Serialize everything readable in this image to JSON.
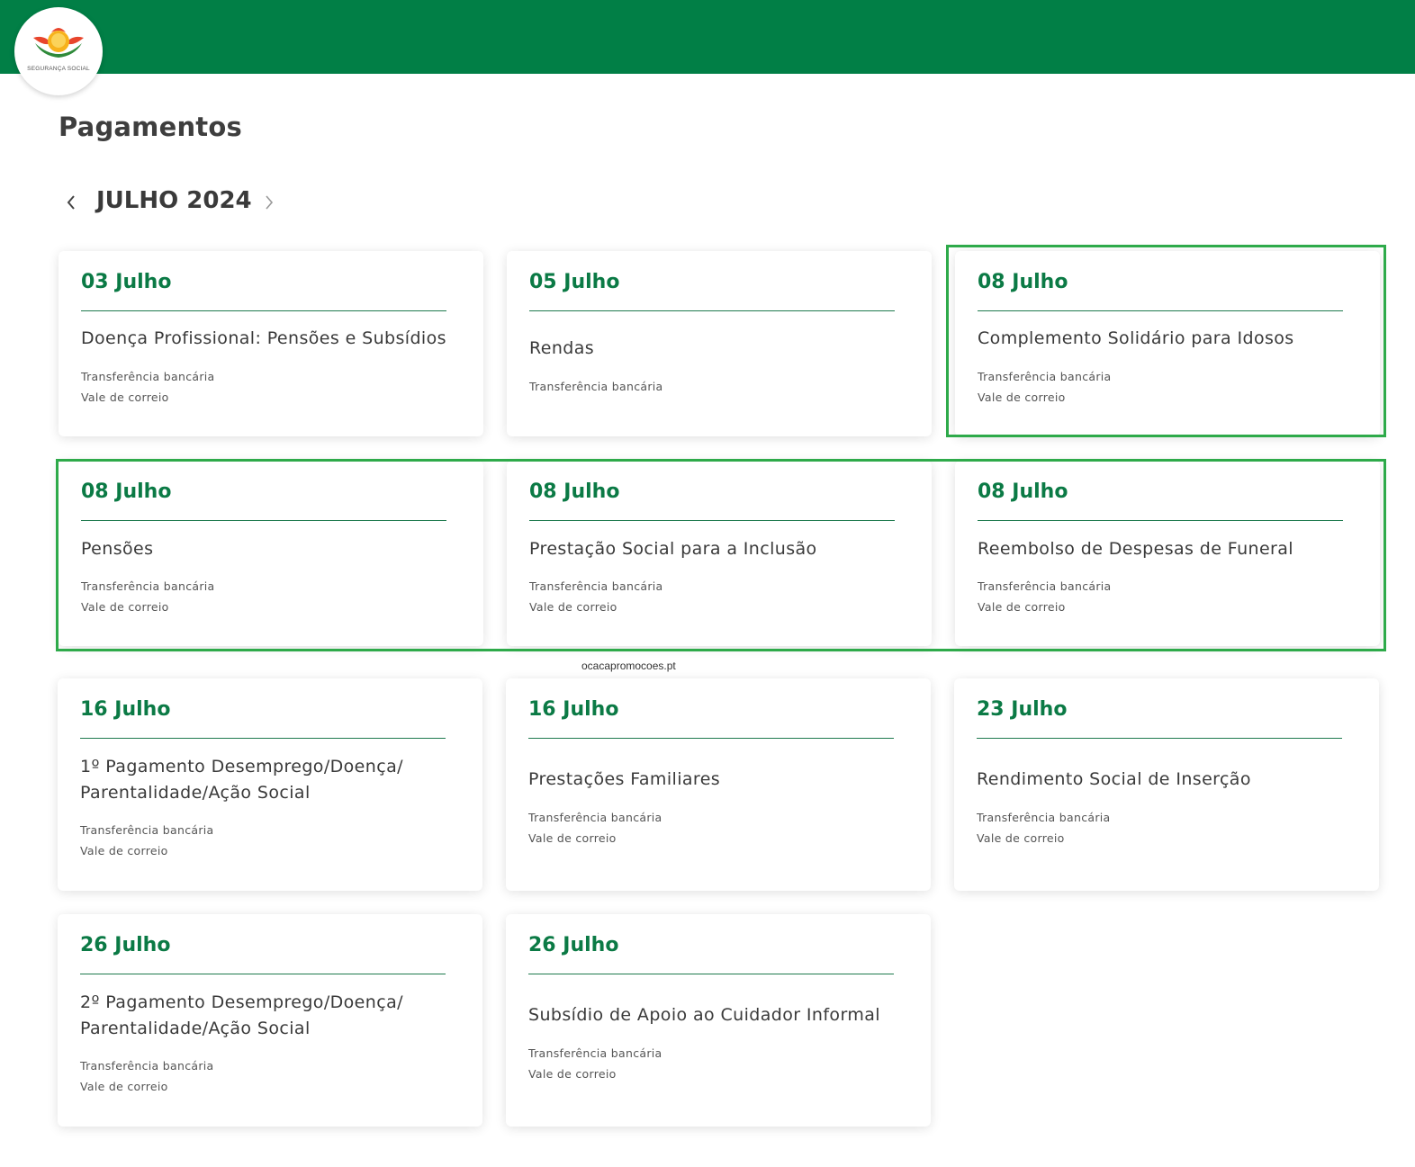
{
  "header": {
    "logo_text": "SEGURANÇA SOCIAL",
    "brand_color": "#017f46",
    "logo_icon": "seguranca-social-logo"
  },
  "page": {
    "title": "Pagamentos"
  },
  "month_nav": {
    "label": "JULHO 2024",
    "prev_icon": "chevron-left-icon",
    "next_icon": "chevron-right-icon"
  },
  "cards": [
    {
      "date": "03 Julho",
      "title": "Doença Profissional: Pensões e Subsídios",
      "methods": [
        "Transferência bancária",
        "Vale de correio"
      ]
    },
    {
      "date": "05 Julho",
      "title": "Rendas",
      "methods": [
        "Transferência bancária"
      ]
    },
    {
      "date": "08 Julho",
      "title": "Complemento Solidário para Idosos",
      "methods": [
        "Transferência bancária",
        "Vale de correio"
      ]
    },
    {
      "date": "08 Julho",
      "title": "Pensões",
      "methods": [
        "Transferência bancária",
        "Vale de correio"
      ]
    },
    {
      "date": "08 Julho",
      "title": "Prestação Social para a Inclusão",
      "methods": [
        "Transferência bancária",
        "Vale de correio"
      ]
    },
    {
      "date": "08 Julho",
      "title": "Reembolso de Despesas de Funeral",
      "methods": [
        "Transferência bancária",
        "Vale de correio"
      ]
    },
    {
      "date": "16 Julho",
      "title": "1º Pagamento Desemprego/Doença/ Parentalidade/Ação Social",
      "methods": [
        "Transferência bancária",
        "Vale de correio"
      ]
    },
    {
      "date": "16 Julho",
      "title": "Prestações Familiares",
      "methods": [
        "Transferência bancária",
        "Vale de correio"
      ]
    },
    {
      "date": "23 Julho",
      "title": "Rendimento Social de Inserção",
      "methods": [
        "Transferência bancária",
        "Vale de correio"
      ]
    },
    {
      "date": "26 Julho",
      "title": "2º Pagamento Desemprego/Doença/ Parentalidade/Ação Social",
      "methods": [
        "Transferência bancária",
        "Vale de correio"
      ]
    },
    {
      "date": "26 Julho",
      "title": "Subsídio de Apoio ao Cuidador Informal",
      "methods": [
        "Transferência bancária",
        "Vale de correio"
      ]
    }
  ],
  "watermark": "ocacapromocoes.pt",
  "highlight_color": "#2eaa4a"
}
